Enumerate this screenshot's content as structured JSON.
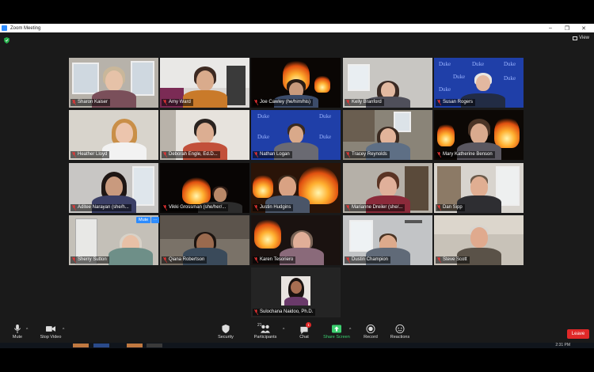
{
  "window": {
    "title": "Zoom Meeting",
    "minimize_glyph": "–",
    "restore_glyph": "❐",
    "close_glyph": "✕"
  },
  "header": {
    "view_label": "View",
    "security_icon": "shield-icon"
  },
  "participants": [
    {
      "name": "Sharon Kaiser"
    },
    {
      "name": "Amy Ward"
    },
    {
      "name": "Joe Cawley (he/him/his)"
    },
    {
      "name": "Kelly Branford"
    },
    {
      "name": "Susan Rogers",
      "active_speaker": true
    },
    {
      "name": "Heather Lloyd"
    },
    {
      "name": "Deborah Engle, Ed.D..."
    },
    {
      "name": "Nathan Logan"
    },
    {
      "name": "Tracey Reynolds"
    },
    {
      "name": "Mary Katherine Benson"
    },
    {
      "name": "Aditee Narayan (she/h..."
    },
    {
      "name": "Vikki Grossman (she/her/..."
    },
    {
      "name": "Justin Hudgins"
    },
    {
      "name": "Marianne Dreiler (she/..."
    },
    {
      "name": "Dan Sipp"
    },
    {
      "name": "Sherry Sutton"
    },
    {
      "name": "Qiana Robertson"
    },
    {
      "name": "Karen Tesoriero"
    },
    {
      "name": "Dustin Champion"
    },
    {
      "name": "Steve Scott"
    },
    {
      "name": "Sulochana Naidoo, Ph.D."
    }
  ],
  "duke_word": "Duke",
  "hover_menu": {
    "mute_label": "Mute",
    "more_label": "···"
  },
  "toolbar": {
    "mute_label": "Mute",
    "stop_video_label": "Stop Video",
    "security_label": "Security",
    "participants_label": "Participants",
    "participants_count": "21",
    "chat_label": "Chat",
    "chat_badge": "1",
    "share_screen_label": "Share Screen",
    "record_label": "Record",
    "reactions_label": "Reactions",
    "leave_label": "Leave",
    "caret": "^"
  },
  "taskbar": {
    "clock": "2:31 PM"
  },
  "colors": {
    "zoom_blue": "#2d8cff",
    "active_speaker_border": "#f0e64d",
    "leave_red": "#e02828",
    "share_green": "#3cd070"
  }
}
